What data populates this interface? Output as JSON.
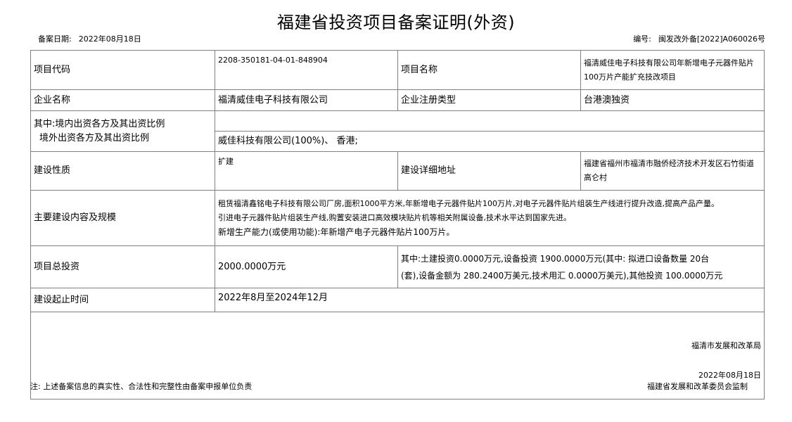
{
  "document": {
    "title": "福建省投资项目备案证明(外资)",
    "filing_date_label": "备案日期:",
    "filing_date": "2022年08月18日",
    "number_label": "编号:",
    "number": "闽发改外备[2022]A060026号"
  },
  "rows": {
    "project_code_label": "项目代码",
    "project_code": "2208-350181-04-01-848904",
    "project_name_label": "项目名称",
    "project_name_line1": "福清威佳电子科技有限公司年新增电子元器件贴片",
    "project_name_line2": "100万片产能扩充技改项目",
    "company_label": "企业名称",
    "company": "福清威佳电子科技有限公司",
    "company_type_label": "企业注册类型",
    "company_type": "台港澳独资",
    "investors_domestic_label": "其中:境内出资各方及其出资比例",
    "investors_foreign_label": "境外出资各方及其出资比例",
    "investors_domestic": "",
    "investors_foreign": "威佳科技有限公司(100%)、 香港;",
    "nature_label": "建设性质",
    "nature": "扩建",
    "address_label": "建设详细地址",
    "address_line1": "福建省福州市福清市融侨经济技术开发区石竹街道",
    "address_line2": "高仑村",
    "content_label": "主要建设内容及规模",
    "content_line1": "租赁福清鑫铭电子科技有限公司厂房,面积1000平方米,年新增电子元器件贴片100万片,对电子元器件贴片组装生产线进行提升改造,提高产品产量。",
    "content_line2": "引进电子元器件贴片组装生产线,购置安装进口高效模块贴片机等相关附属设备,技术水平达到国家先进。",
    "content_line3": "新增生产能力(或使用功能):年新增产电子元器件贴片100万片。",
    "investment_label": "项目总投资",
    "investment_total": "2000.0000万元",
    "investment_detail_line1": "其中:土建投资0.0000万元,设备投资 1900.0000万元(其中: 拟进口设备数量 20台",
    "investment_detail_line2": "(套),设备金额为 280.2400万美元,技术用汇 0.0000万美元),其他投资 100.0000万元",
    "period_label": "建设起止时间",
    "period": "2022年8月至2024年12月"
  },
  "signature": {
    "org": "福清市发展和改革局",
    "date": "2022年08月18日"
  },
  "footer": {
    "note": "注: 上述备案信息的真实性、合法性和完整性由备案申报单位负责",
    "supervisor": "福建省发展和改革委员会监制"
  }
}
